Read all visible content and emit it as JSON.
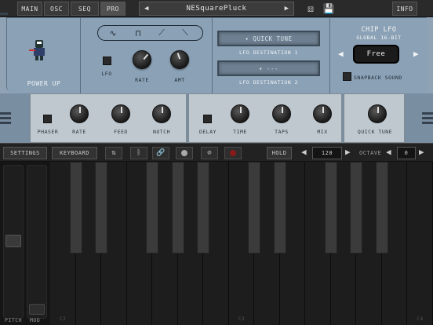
{
  "topbar": {
    "tabs": [
      {
        "label": "MAIN"
      },
      {
        "label": "OSC"
      },
      {
        "label": "SEQ"
      },
      {
        "label": "PRO"
      }
    ],
    "preset_name": "NESquarePluck",
    "info_label": "INFO"
  },
  "panel": {
    "logo_text": "POWER UP",
    "lfo_label": "LFO",
    "rate_label": "RATE",
    "amt_label": "AMT",
    "dest1_value": "▾ QUICK TUNE",
    "dest1_label": "LFO DESTINATION 1",
    "dest2_value": "▾ ---",
    "dest2_label": "LFO DESTINATION 2",
    "chip_title": "CHIP LFO",
    "chip_sub": "GLOBAL 16-BIT",
    "mode_value": "Free",
    "snapback_label": "SNAPBACK SOUND"
  },
  "fx": {
    "phaser_label": "PHASER",
    "rate_label": "RATE",
    "feed_label": "FEED",
    "notch_label": "NOTCH",
    "delay_label": "DELAY",
    "time_label": "TIME",
    "taps_label": "TAPS",
    "mix_label": "MIX",
    "quicktune_label": "QUICK TUNE"
  },
  "toolbar": {
    "settings_label": "SETTINGS",
    "keyboard_label": "KEYBOARD",
    "hold_label": "HOLD",
    "tempo_value": "120",
    "octave_label": "OCTAVE",
    "octave_value": "0"
  },
  "keyboard": {
    "pitch_label": "PITCH",
    "mod_label": "MOD",
    "octave_marks": [
      "C2",
      "C3",
      "C4"
    ]
  },
  "colors": {
    "panel": "#8ba1b5",
    "dark": "#1c1c1c",
    "record": "#8a1a1a"
  }
}
